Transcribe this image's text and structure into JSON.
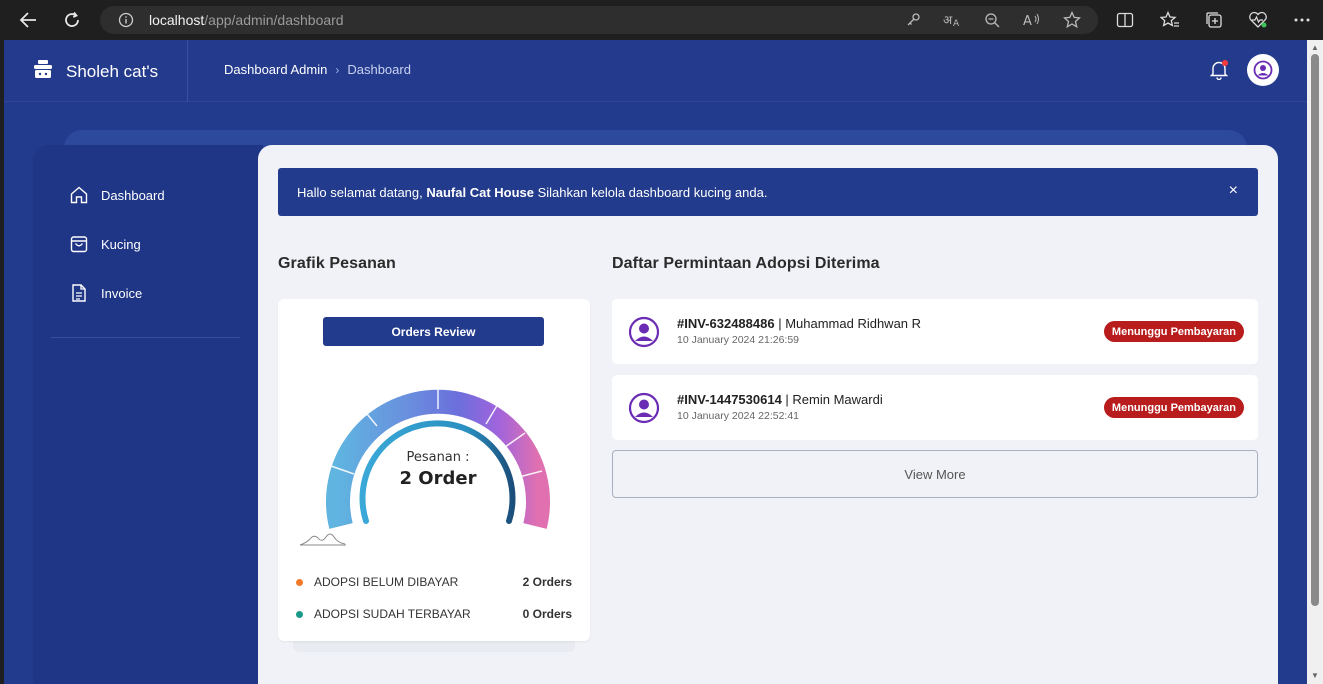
{
  "browser": {
    "url_host": "localhost",
    "url_path": "/app/admin/dashboard"
  },
  "header": {
    "brand": "Sholeh cat's",
    "breadcrumb": [
      "Dashboard Admin",
      "Dashboard"
    ]
  },
  "sidebar": {
    "items": [
      {
        "label": "Dashboard",
        "icon": "home-icon"
      },
      {
        "label": "Kucing",
        "icon": "bag-icon"
      },
      {
        "label": "Invoice",
        "icon": "document-icon"
      }
    ]
  },
  "alert": {
    "prefix": "Hallo selamat datang, ",
    "name": "Naufal Cat House",
    "suffix": " Silahkan kelola dashboard kucing anda.",
    "close": "×"
  },
  "orders_chart": {
    "section_title": "Grafik Pesanan",
    "button": "Orders Review",
    "center_label": "Pesanan :",
    "center_value": "2 Order",
    "legend": [
      {
        "label": "ADOPSI BELUM DIBAYAR",
        "value": "2 Orders",
        "color": "#f07a2a"
      },
      {
        "label": "ADOPSI SUDAH TERBAYAR",
        "value": "0 Orders",
        "color": "#1a9a8a"
      }
    ]
  },
  "adoption_list": {
    "section_title": "Daftar Permintaan Adopsi Diterima",
    "items": [
      {
        "invoice": "#INV-632488486",
        "name": " | Muhammad Ridhwan R",
        "date": "10 January 2024 21:26:59",
        "status": "Menunggu Pembayaran"
      },
      {
        "invoice": "#INV-1447530614",
        "name": " | Remin Mawardi",
        "date": "10 January 2024 22:52:41",
        "status": "Menunggu Pembayaran"
      }
    ],
    "view_more": "View More"
  },
  "colors": {
    "primary": "#233b8c",
    "badge": "#b81c1c",
    "avatar": "#6a2bb5"
  }
}
